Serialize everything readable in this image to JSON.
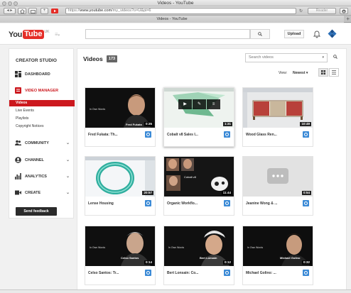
{
  "window": {
    "title": "Videos - YouTube",
    "tab_title": "Videos - YouTube"
  },
  "browser": {
    "url_scheme": "https://",
    "url_host": "www.youtube.com",
    "url_path": "/my_videos?o=U&pi=6",
    "reader_label": "Reader",
    "reload_icon": "reload-icon"
  },
  "header": {
    "logo_you": "You",
    "logo_tube": "Tube",
    "logo_region": "UK",
    "search_placeholder": "",
    "upload_label": "Upload"
  },
  "sidebar": {
    "title": "CREATOR STUDIO",
    "dashboard": "DASHBOARD",
    "video_manager": "VIDEO MANAGER",
    "sub": [
      "Videos",
      "Live Events",
      "Playlists",
      "Copyright Notices"
    ],
    "community": "COMMUNITY",
    "channel": "CHANNEL",
    "analytics": "ANALYTICS",
    "create": "CREATE",
    "feedback": "Send feedback"
  },
  "main": {
    "title": "Videos",
    "count": "173",
    "search_placeholder": "Search videos",
    "view_label": "View:",
    "sort_label": "Newest ▾"
  },
  "videos": [
    {
      "title": "Fred Fukata: Th...",
      "duration": "0:35",
      "thumb_caption": "Fred Fukata",
      "thumb_tag": "In Own Words"
    },
    {
      "title": "Cobalt v8 Sales I...",
      "duration": "1:31"
    },
    {
      "title": "Wood Glass Ren...",
      "duration": "10:49"
    },
    {
      "title": "Lense Housing",
      "duration": "20:57"
    },
    {
      "title": "Organic Workflo...",
      "duration": "11:44",
      "thumb_caption": "Cobalt v8"
    },
    {
      "title": "Jeanine Wong & ...",
      "duration": "0:54"
    },
    {
      "title": "Celso Santos: Tr...",
      "duration": "0:14",
      "thumb_caption": "Celso Santos",
      "thumb_tag": "In Own Words"
    },
    {
      "title": "Bert Lonsain: Co...",
      "duration": "0:12",
      "thumb_caption": "Bert Lonsain",
      "thumb_tag": "In Own Words"
    },
    {
      "title": "Michael Golino: ...",
      "duration": "0:32",
      "thumb_caption": "Michael Golino",
      "thumb_tag": "In Own Words"
    }
  ],
  "colors": {
    "brand_red": "#e52d27",
    "active_red": "#cc181e",
    "globe_blue": "#3b8ad6"
  }
}
